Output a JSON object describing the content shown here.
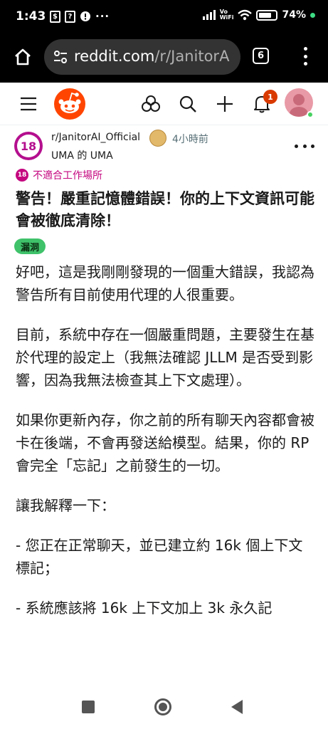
{
  "status_bar": {
    "time": "1:43",
    "battery_pct": "74%",
    "volte_line1": "Vo",
    "volte_line2": "WiFi",
    "overflow": "···",
    "battery_level": 0.74
  },
  "browser": {
    "url_host": "reddit.com",
    "url_path": "/r/JanitorA",
    "tab_count": "6"
  },
  "reddit_header": {
    "notification_count": "1"
  },
  "post": {
    "subreddit": "r/JanitorAI_Official",
    "time_ago": "4小時前",
    "author_line": "UMA 的 UMA",
    "subreddit_icon_text": "18",
    "nsfw_icon_text": "18",
    "nsfw_label": "不適合工作場所",
    "title": "警告！嚴重記憶體錯誤！你的上下文資訊可能會被徹底清除！",
    "flair": "漏洞",
    "paragraphs": [
      "好吧，這是我剛剛發現的一個重大錯誤，我認為警告所有目前使用代理的人很重要。",
      "目前，系統中存在一個嚴重問題，主要發生在基於代理的設定上（我無法確認 JLLM 是否受到影響，因為我無法檢查其上下文處理）。",
      "如果你更新內存，你之前的所有聊天內容都會被卡在後端，不會再發送給模型。結果，你的 RP 會完全「忘記」之前發生的一切。",
      "讓我解釋一下：",
      "- 您正在正常聊天，並已建立約 16k 個上下文標記；",
      "- 系統應該將 16k 上下文加上 3k 永久記"
    ]
  },
  "colors": {
    "nsfw": "#c4067f",
    "flair_bg": "#3fc26a",
    "reddit_orange": "#ff4500",
    "notification": "#d93a00"
  }
}
